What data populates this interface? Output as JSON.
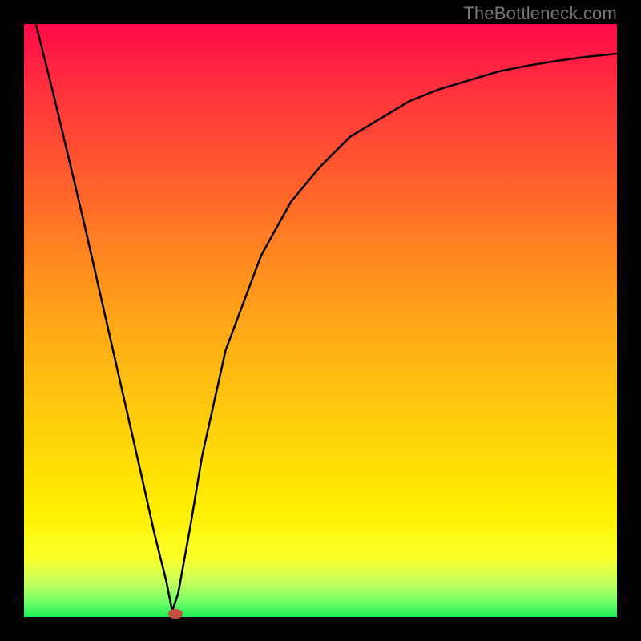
{
  "watermark": "TheBottleneck.com",
  "chart_data": {
    "type": "line",
    "title": "",
    "xlabel": "",
    "ylabel": "",
    "xlim": [
      0,
      100
    ],
    "ylim": [
      0,
      100
    ],
    "grid": false,
    "legend": false,
    "background": "vertical-gradient red→orange→yellow→green",
    "series": [
      {
        "name": "curve",
        "color": "#000000",
        "x": [
          2,
          5,
          10,
          15,
          20,
          22,
          24,
          25,
          26,
          28,
          30,
          34,
          40,
          45,
          50,
          55,
          60,
          65,
          70,
          75,
          80,
          85,
          90,
          95,
          100
        ],
        "y": [
          100,
          88,
          67,
          45,
          23,
          14,
          6,
          1,
          4,
          15,
          27,
          45,
          61,
          70,
          76,
          81,
          84,
          87,
          89,
          90.5,
          92,
          93,
          93.8,
          94.5,
          95
        ]
      }
    ],
    "marker": {
      "x": 25.5,
      "y": 0.5,
      "color": "#c05040"
    },
    "colors": {
      "frame": "#000000",
      "gradient_top": "#ff0a4a",
      "gradient_bottom": "#1fef57"
    }
  }
}
